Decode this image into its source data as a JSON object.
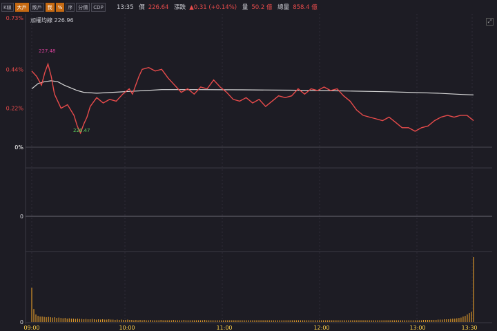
{
  "toolbar": {
    "buttons": [
      {
        "label": "K線",
        "active": false
      },
      {
        "label": "大戶",
        "active": true
      },
      {
        "label": "散戶",
        "active": false
      },
      {
        "label": "我",
        "active": true
      },
      {
        "label": "%",
        "active": true
      },
      {
        "label": "序",
        "active": false
      },
      {
        "label": "分價",
        "active": false
      },
      {
        "label": "CDP",
        "active": false
      }
    ]
  },
  "quote": {
    "time": "13:35",
    "price_label": "價",
    "price": "226.64",
    "change_label": "漲跌",
    "change": "▲0.31 (+0.14%)",
    "volume_label": "量",
    "volume": "50.2 億",
    "total_label": "總量",
    "total": "858.4 億"
  },
  "avg_line_label": "加權均線 226.96",
  "colors": {
    "up": "#e84b4b",
    "avg": "#d8d8d8",
    "volume": "#d8952a",
    "high_label": "#d6409a",
    "low_label": "#5fd35f"
  },
  "chart_data": {
    "type": "line",
    "x_ticks": [
      "09:00",
      "10:00",
      "11:00",
      "12:00",
      "13:00",
      "13:30"
    ],
    "price_ticks": [
      "0.73%",
      "0.44%",
      "0.22%",
      "0%"
    ],
    "volume_axis_label": "0",
    "volume_bottom_label": "0",
    "high_annotation": "227.48",
    "low_annotation": "226.47",
    "price_pct": [
      [
        0,
        0.43
      ],
      [
        3,
        0.4
      ],
      [
        6,
        0.35
      ],
      [
        8,
        0.42
      ],
      [
        10,
        0.47
      ],
      [
        12,
        0.4
      ],
      [
        14,
        0.3
      ],
      [
        18,
        0.22
      ],
      [
        22,
        0.24
      ],
      [
        26,
        0.18
      ],
      [
        28,
        0.12
      ],
      [
        30,
        0.08
      ],
      [
        32,
        0.13
      ],
      [
        34,
        0.17
      ],
      [
        36,
        0.23
      ],
      [
        40,
        0.28
      ],
      [
        44,
        0.25
      ],
      [
        48,
        0.27
      ],
      [
        52,
        0.26
      ],
      [
        56,
        0.3
      ],
      [
        60,
        0.33
      ],
      [
        62,
        0.3
      ],
      [
        64,
        0.35
      ],
      [
        66,
        0.4
      ],
      [
        68,
        0.44
      ],
      [
        72,
        0.45
      ],
      [
        76,
        0.43
      ],
      [
        80,
        0.44
      ],
      [
        84,
        0.39
      ],
      [
        88,
        0.35
      ],
      [
        92,
        0.31
      ],
      [
        96,
        0.33
      ],
      [
        100,
        0.3
      ],
      [
        104,
        0.34
      ],
      [
        108,
        0.33
      ],
      [
        112,
        0.38
      ],
      [
        116,
        0.34
      ],
      [
        120,
        0.31
      ],
      [
        124,
        0.27
      ],
      [
        128,
        0.26
      ],
      [
        132,
        0.28
      ],
      [
        136,
        0.25
      ],
      [
        140,
        0.27
      ],
      [
        144,
        0.23
      ],
      [
        148,
        0.26
      ],
      [
        152,
        0.29
      ],
      [
        156,
        0.28
      ],
      [
        160,
        0.29
      ],
      [
        164,
        0.33
      ],
      [
        168,
        0.3
      ],
      [
        172,
        0.33
      ],
      [
        176,
        0.32
      ],
      [
        180,
        0.34
      ],
      [
        184,
        0.32
      ],
      [
        188,
        0.33
      ],
      [
        192,
        0.29
      ],
      [
        196,
        0.26
      ],
      [
        200,
        0.21
      ],
      [
        204,
        0.18
      ],
      [
        208,
        0.17
      ],
      [
        212,
        0.16
      ],
      [
        216,
        0.15
      ],
      [
        220,
        0.17
      ],
      [
        224,
        0.14
      ],
      [
        228,
        0.11
      ],
      [
        232,
        0.11
      ],
      [
        236,
        0.09
      ],
      [
        240,
        0.11
      ],
      [
        244,
        0.12
      ],
      [
        248,
        0.15
      ],
      [
        252,
        0.17
      ],
      [
        256,
        0.18
      ],
      [
        260,
        0.17
      ],
      [
        264,
        0.18
      ],
      [
        268,
        0.18
      ],
      [
        272,
        0.15
      ]
    ],
    "avg_pct": [
      [
        0,
        0.33
      ],
      [
        4,
        0.36
      ],
      [
        8,
        0.37
      ],
      [
        12,
        0.375
      ],
      [
        16,
        0.37
      ],
      [
        20,
        0.35
      ],
      [
        24,
        0.335
      ],
      [
        28,
        0.32
      ],
      [
        32,
        0.31
      ],
      [
        40,
        0.305
      ],
      [
        50,
        0.31
      ],
      [
        60,
        0.315
      ],
      [
        70,
        0.32
      ],
      [
        80,
        0.325
      ],
      [
        100,
        0.325
      ],
      [
        130,
        0.324
      ],
      [
        160,
        0.322
      ],
      [
        190,
        0.318
      ],
      [
        220,
        0.313
      ],
      [
        250,
        0.305
      ],
      [
        265,
        0.298
      ],
      [
        272,
        0.295
      ]
    ],
    "volume": [
      1.0,
      0.38,
      0.22,
      0.18,
      0.16,
      0.16,
      0.15,
      0.14,
      0.15,
      0.14,
      0.13,
      0.14,
      0.12,
      0.13,
      0.12,
      0.11,
      0.12,
      0.1,
      0.11,
      0.1,
      0.1,
      0.09,
      0.1,
      0.09,
      0.09,
      0.08,
      0.09,
      0.08,
      0.08,
      0.09,
      0.08,
      0.07,
      0.08,
      0.07,
      0.08,
      0.07,
      0.07,
      0.08,
      0.07,
      0.07,
      0.06,
      0.07,
      0.06,
      0.07,
      0.06,
      0.06,
      0.07,
      0.06,
      0.06,
      0.05,
      0.06,
      0.05,
      0.06,
      0.05,
      0.06,
      0.05,
      0.05,
      0.06,
      0.05,
      0.05,
      0.05,
      0.05,
      0.06,
      0.05,
      0.05,
      0.05,
      0.05,
      0.05,
      0.06,
      0.05,
      0.05,
      0.05,
      0.05,
      0.06,
      0.05,
      0.05,
      0.05,
      0.05,
      0.05,
      0.05,
      0.05,
      0.05,
      0.05,
      0.06,
      0.05,
      0.05,
      0.05,
      0.05,
      0.05,
      0.05,
      0.05,
      0.05,
      0.05,
      0.05,
      0.05,
      0.05,
      0.05,
      0.05,
      0.05,
      0.05,
      0.05,
      0.05,
      0.05,
      0.05,
      0.05,
      0.05,
      0.05,
      0.05,
      0.05,
      0.05,
      0.05,
      0.05,
      0.05,
      0.05,
      0.05,
      0.05,
      0.05,
      0.05,
      0.05,
      0.05,
      0.05,
      0.05,
      0.05,
      0.05,
      0.05,
      0.05,
      0.05,
      0.05,
      0.05,
      0.05,
      0.05,
      0.05,
      0.05,
      0.05,
      0.05,
      0.05,
      0.05,
      0.05,
      0.05,
      0.05,
      0.05,
      0.05,
      0.05,
      0.05,
      0.05,
      0.05,
      0.05,
      0.05,
      0.05,
      0.05,
      0.05,
      0.05,
      0.05,
      0.05,
      0.05,
      0.05,
      0.05,
      0.05,
      0.05,
      0.05,
      0.05,
      0.05,
      0.05,
      0.05,
      0.05,
      0.05,
      0.05,
      0.05,
      0.05,
      0.05,
      0.05,
      0.05,
      0.05,
      0.05,
      0.05,
      0.05,
      0.05,
      0.05,
      0.05,
      0.05,
      0.05,
      0.05,
      0.05,
      0.05,
      0.05,
      0.05,
      0.05,
      0.05,
      0.06,
      0.06,
      0.06,
      0.06,
      0.06,
      0.06,
      0.06,
      0.07,
      0.07,
      0.07,
      0.08,
      0.08,
      0.08,
      0.09,
      0.1,
      0.1,
      0.11,
      0.12,
      0.13,
      0.16,
      0.18,
      0.22,
      0.26,
      0.3,
      1.9
    ]
  }
}
